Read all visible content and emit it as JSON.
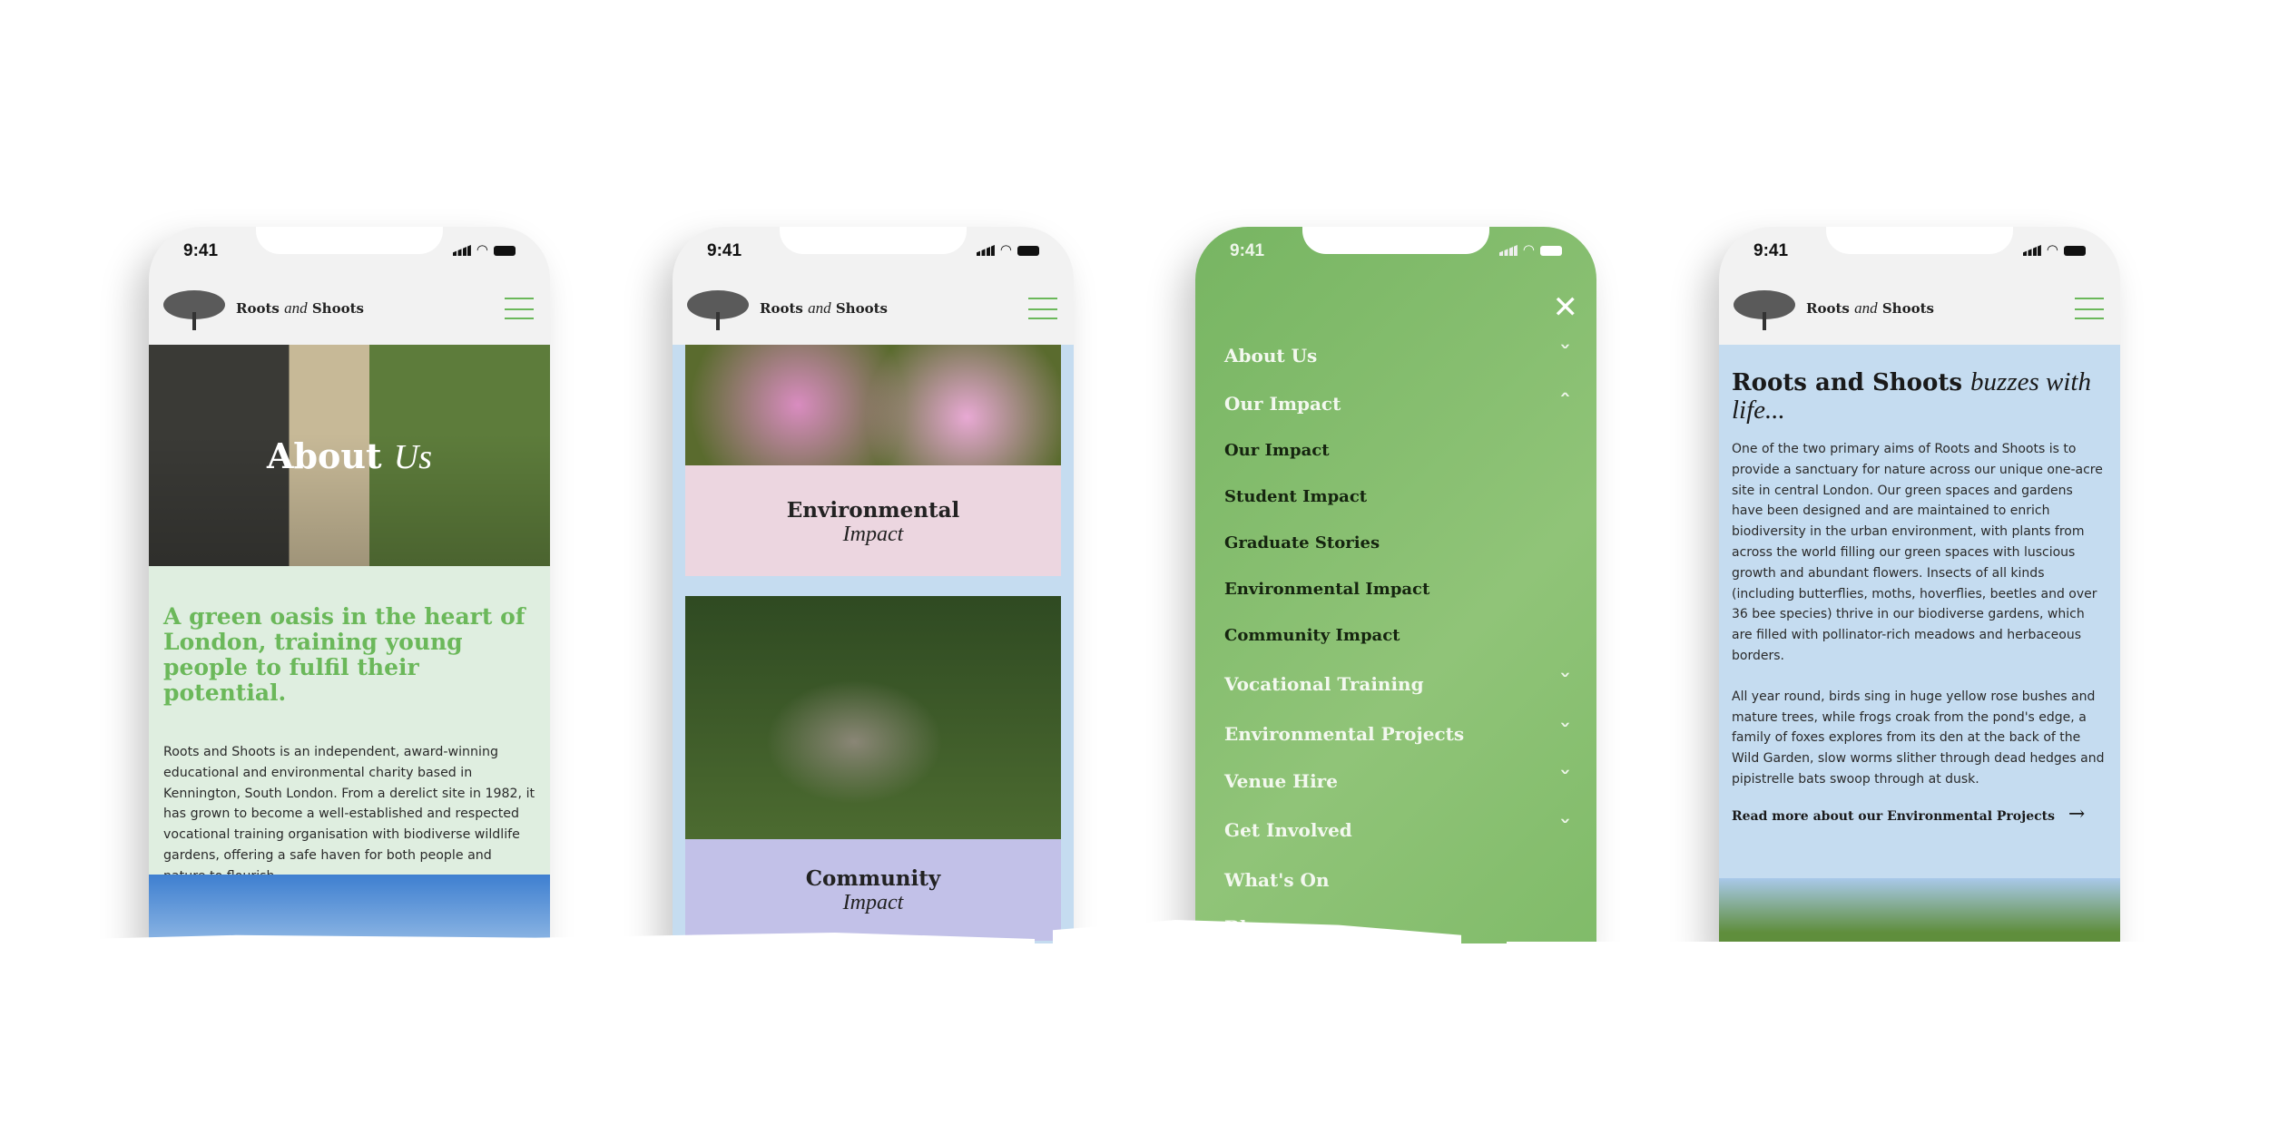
{
  "status": {
    "time": "9:41"
  },
  "brand": {
    "name_a": "Roots",
    "name_and": "and",
    "name_b": "Shoots"
  },
  "colors": {
    "accent_green": "#6bb85a",
    "menu_bg": "#7dbb66",
    "pale_green": "#dfeee0",
    "pale_blue": "#c5dcf0",
    "pink": "#ecd6e0",
    "lavender": "#c2c1e8"
  },
  "about": {
    "hero_bold": "About",
    "hero_italic": "Us",
    "heading": "A green oasis in the heart of London, training young people to fulfil their potential.",
    "paragraph": "Roots and Shoots is an independent, award-winning educational and environmental charity based in Kennington, South London. From a derelict site in 1982, it has grown to become a well-established and respected vocational training organisation with biodiverse wildlife gardens, offering a safe haven for both people and nature to flourish."
  },
  "impact": {
    "cards": [
      {
        "title": "Environmental",
        "subtitle": "Impact"
      },
      {
        "title": "Community",
        "subtitle": "Impact"
      }
    ]
  },
  "menu": {
    "items": [
      {
        "label": "About Us",
        "icon": "chevron-down",
        "sub": false
      },
      {
        "label": "Our Impact",
        "icon": "chevron-up",
        "sub": false
      },
      {
        "label": "Our Impact",
        "sub": true
      },
      {
        "label": "Student Impact",
        "sub": true
      },
      {
        "label": "Graduate Stories",
        "sub": true
      },
      {
        "label": "Environmental Impact",
        "sub": true
      },
      {
        "label": "Community Impact",
        "sub": true
      },
      {
        "label": "Vocational Training",
        "icon": "chevron-down",
        "sub": false
      },
      {
        "label": "Environmental Projects",
        "icon": "chevron-down",
        "sub": false
      },
      {
        "label": "Venue Hire",
        "icon": "chevron-down",
        "sub": false
      },
      {
        "label": "Get Involved",
        "icon": "chevron-down",
        "sub": false
      },
      {
        "label": "What's On",
        "sub": false
      },
      {
        "label": "Blog",
        "sub": false
      }
    ]
  },
  "env": {
    "title_bold": "Roots and Shoots",
    "title_italic": "buzzes with life...",
    "p1": "One of the two primary aims of Roots and Shoots is to provide a sanctuary for nature across our unique one-acre site in central London. Our green spaces and gardens have been designed and are maintained to enrich biodiversity in the urban environment, with plants from across the world filling our green spaces with luscious growth and abundant flowers. Insects of all kinds (including butterflies, moths, hoverflies, beetles and over 36 bee species) thrive in our biodiverse gardens, which are filled with pollinator-rich meadows and herbaceous borders.",
    "p2": "All year round, birds sing in huge yellow rose bushes and mature trees, while frogs croak from the pond's edge, a family of foxes explores from its den at the back of the Wild Garden, slow worms slither through dead hedges and pipistrelle bats swoop through at dusk.",
    "link": "Read more about our Environmental Projects"
  }
}
